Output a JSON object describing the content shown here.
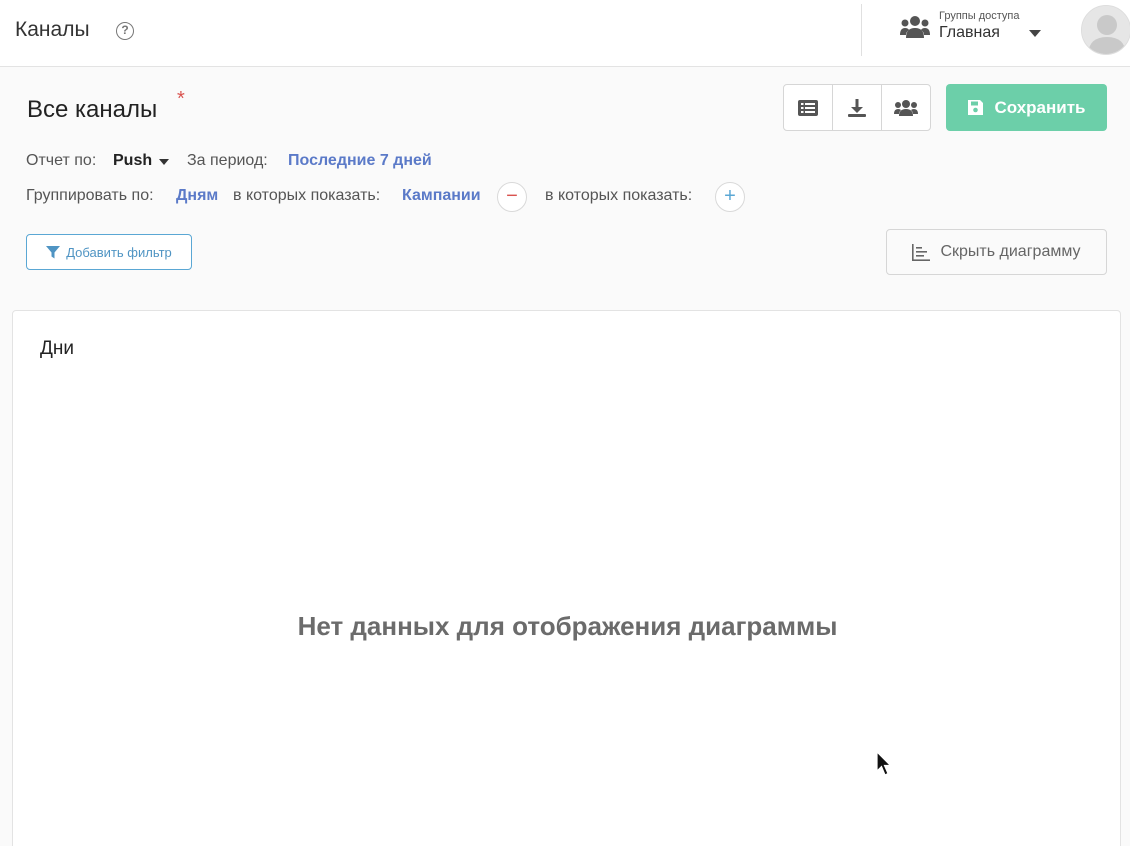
{
  "header": {
    "title": "Каналы",
    "help_icon": "?",
    "access_group_caption": "Группы доступа",
    "access_group_value": "Главная"
  },
  "report": {
    "title": "Все каналы",
    "required_mark": "*",
    "save_label": "Сохранить",
    "report_by_label": "Отчет по:",
    "report_by_value": "Push",
    "period_label": "За период:",
    "period_value": "Последние 7 дней",
    "group_by_label": "Группировать по:",
    "group_by_value": "Дням",
    "show_in_label_1": "в которых показать:",
    "show_in_value_1": "Кампании",
    "remove_symbol": "−",
    "show_in_label_2": "в которых показать:",
    "add_symbol": "+",
    "add_filter_label": "Добавить фильтр",
    "hide_chart_label": "Скрыть диаграмму"
  },
  "chart_panel": {
    "title": "Дни",
    "empty_message": "Нет данных для отображения диаграммы"
  },
  "icons": {
    "toolbar": [
      "list-icon",
      "download-icon",
      "users-icon"
    ],
    "save": "save-icon",
    "filter": "filter-icon",
    "hide_chart": "chart-icon"
  },
  "colors": {
    "accent_link": "#5b7ac8",
    "save_button": "#6ccfa9",
    "required_mark": "#d9534f",
    "filter_border": "#5aa7d4"
  }
}
